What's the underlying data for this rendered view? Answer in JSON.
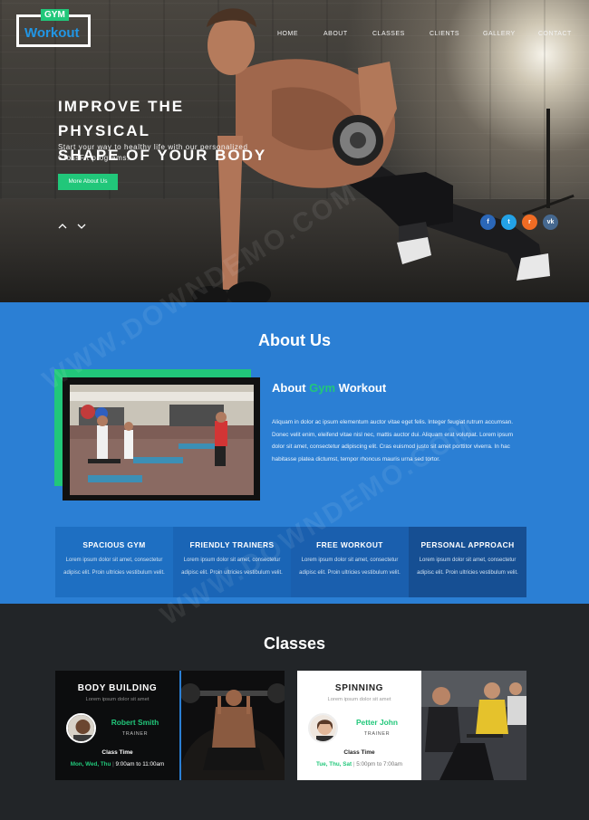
{
  "logo": {
    "top": "GYM",
    "main": "Workout"
  },
  "nav": [
    "HOME",
    "ABOUT",
    "CLASSES",
    "CLIENTS",
    "GALLERY",
    "CONTACT"
  ],
  "hero": {
    "title_line1": "IMPROVE THE PHYSICAL",
    "title_line2": "SHAPE OF YOUR BODY",
    "subtitle_line1": "Start your way to healthy life with our personalized",
    "subtitle_line2": "CrossFit programs.",
    "button": "More About Us",
    "social": [
      {
        "icon": "facebook-icon",
        "glyph": "f",
        "color": "#2b67b8"
      },
      {
        "icon": "twitter-icon",
        "glyph": "t",
        "color": "#23a2e6"
      },
      {
        "icon": "rss-icon",
        "glyph": "r",
        "color": "#f06c24"
      },
      {
        "icon": "vk-icon",
        "glyph": "vk",
        "color": "#46688f"
      }
    ]
  },
  "about": {
    "title": "About Us",
    "heading_pre": "About ",
    "heading_accent": "Gym",
    "heading_post": " Workout",
    "text": "Aliquam in dolor ac ipsum elementum auctor vitae eget felis. Integer feugiat rutrum accumsan. Donec velit enim, eleifend vitae nisl nec, mattis auctor dui. Aliquam erat volutpat. Lorem ipsum dolor sit amet, consectetur adipiscing elit. Cras euismod justo sit amet porttitor viverra. In hac habitasse platea dictumst, tempor rhoncus mauris urna sed tortor.",
    "features": [
      {
        "title": "SPACIOUS GYM",
        "text": "Lorem ipsum dolor sit amet, consectetur adipisc elit. Proin ultricies vestibulum velit."
      },
      {
        "title": "FRIENDLY TRAINERS",
        "text": "Lorem ipsum dolor sit amet, consectetur adipisc elit. Proin ultricies vestibulum velit."
      },
      {
        "title": "FREE WORKOUT",
        "text": "Lorem ipsum dolor sit amet, consectetur adipisc elit. Proin ultricies vestibulum velit."
      },
      {
        "title": "PERSONAL APPROACH",
        "text": "Lorem ipsum dolor sit amet, consectetur adipisc elit. Proin ultricies vestibulum velit."
      }
    ],
    "feature_colors": [
      "#1e6fc2",
      "#1a65b6",
      "#1a5fae",
      "#164f93"
    ]
  },
  "classes": {
    "title": "Classes",
    "cards": [
      {
        "name": "BODY BUILDING",
        "subtitle": "Lorem ipsum dolor sit amet",
        "trainer": "Robert Smith",
        "role": "TRAINER",
        "time_label": "Class Time",
        "days": "Mon, Wed, Thu",
        "hours": "9:00am to 11:00am"
      },
      {
        "name": "SPINNING",
        "subtitle": "Lorem ipsum dolor sit amet",
        "trainer": "Petter John",
        "role": "TRAINER",
        "time_label": "Class Time",
        "days": "Tue, Thu, Sat",
        "hours": "5:00pm to 7:00am"
      }
    ]
  },
  "colors": {
    "accent_green": "#21c77a",
    "about_blue": "#2b7fd4",
    "dark_bg": "#222528"
  }
}
